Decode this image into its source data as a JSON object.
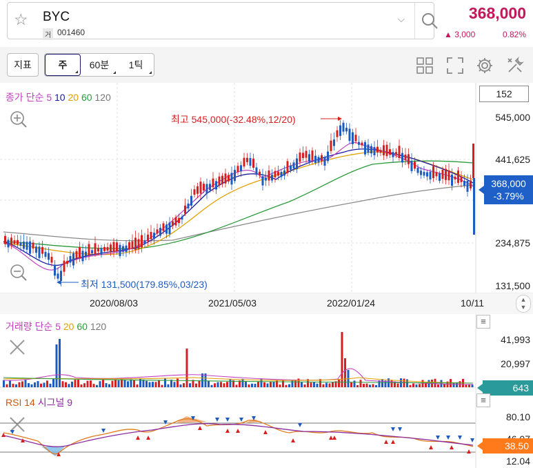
{
  "header": {
    "symbol": "BYC",
    "exchange_badge": "거",
    "code": "001460",
    "price": "368,000",
    "change": "▲ 3,000",
    "change_pct": "0.82%"
  },
  "toolbar": {
    "indicator_label": "지표",
    "period_tabs": [
      {
        "label": "주",
        "active": true
      },
      {
        "label": "60분",
        "active": false
      },
      {
        "label": "1틱",
        "active": false
      }
    ],
    "icons": [
      "grid-icon",
      "fullscreen-icon",
      "settings-icon",
      "tools-icon"
    ]
  },
  "price_panel": {
    "legend_prefix": "종가 단순",
    "ma": [
      {
        "period": "5",
        "color": "#c040c0"
      },
      {
        "period": "10",
        "color": "#1a1aa0"
      },
      {
        "period": "20",
        "color": "#e0a000"
      },
      {
        "period": "60",
        "color": "#2a9a3a"
      },
      {
        "period": "120",
        "color": "#777777"
      }
    ],
    "count_box": "152",
    "axis_labels": [
      "545,000",
      "441,625",
      "234,875",
      "131,500"
    ],
    "price_tag_value": "368,000",
    "price_tag_pct": "-3.79%",
    "high_annotation": "최고 545,000(-32.48%,12/20)",
    "low_annotation": "최저 131,500(179.85%,03/23)",
    "x_dates": [
      "2020/08/03",
      "2021/05/03",
      "2022/01/24",
      "10/11"
    ]
  },
  "volume_panel": {
    "legend_prefix": "거래량 단순",
    "ma": [
      {
        "period": "5",
        "color": "#c040c0"
      },
      {
        "period": "20",
        "color": "#e0a000"
      },
      {
        "period": "60",
        "color": "#2a9a3a"
      },
      {
        "period": "120",
        "color": "#777777"
      }
    ],
    "axis_labels": [
      "41,993",
      "20,997"
    ],
    "tag_value": "643"
  },
  "rsi_panel": {
    "label_main": "RSI 14",
    "label_signal": "시그널 9",
    "axis_labels": [
      "80.10",
      "46.07",
      "12.04"
    ],
    "tag_value": "38.50"
  },
  "colors": {
    "up": "#d62020",
    "down": "#1e5bbf",
    "accent": "#c2185b",
    "price_tag": "#1e60c8",
    "volume_tag": "#2a9a9a",
    "rsi_tag": "#ff7a1a"
  }
}
